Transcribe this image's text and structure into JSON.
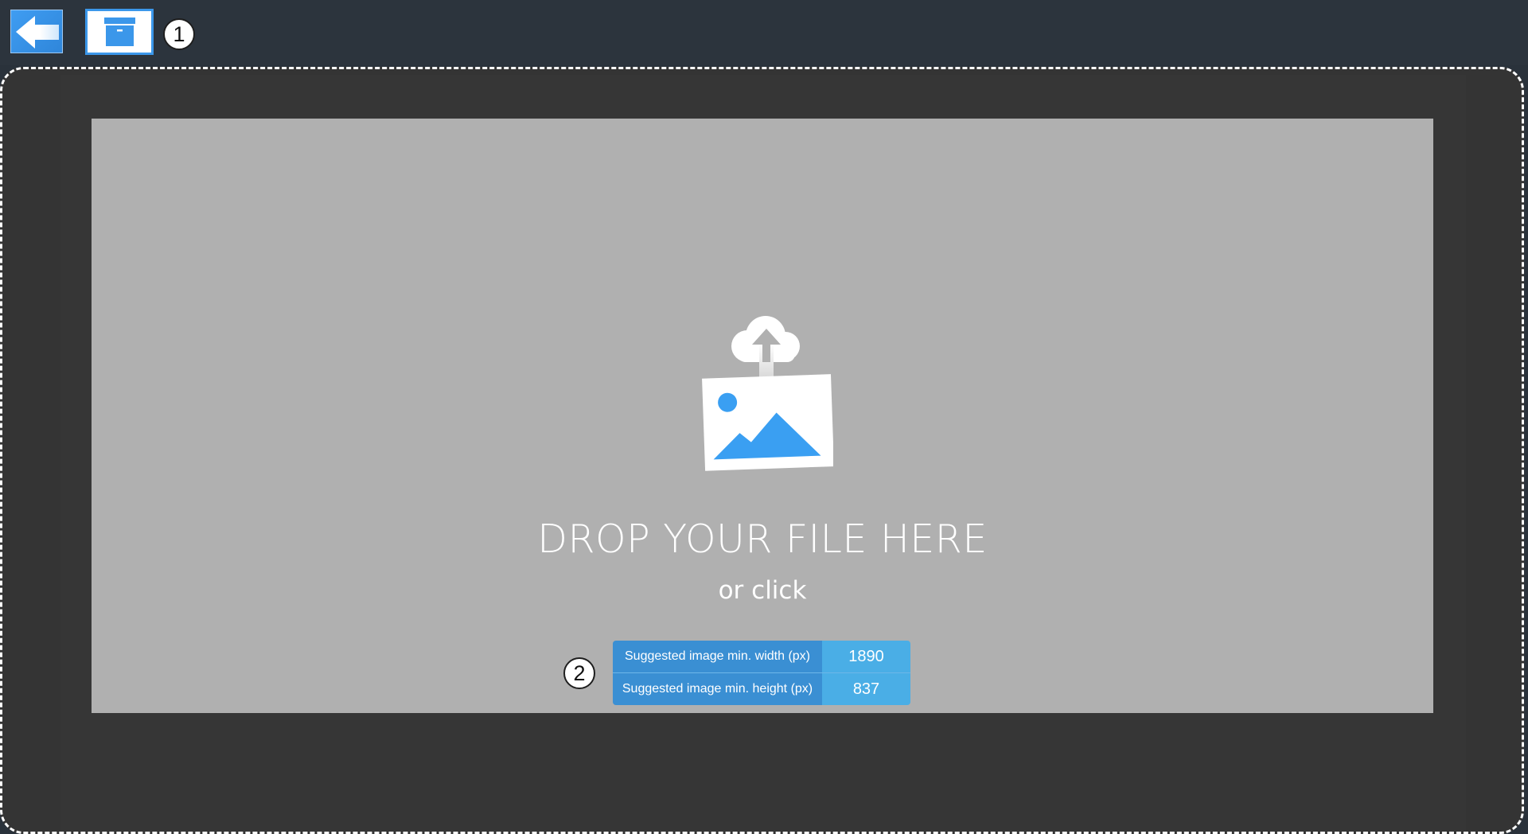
{
  "toolbar": {
    "back_icon": "arrow-left-icon",
    "archive_icon": "archive-box-icon",
    "marker_1": "1"
  },
  "dropzone": {
    "icon": "cloud-upload-image-icon",
    "title": "DROP YOUR FILE HERE",
    "subtitle": "or click",
    "marker_2": "2",
    "requirements": [
      {
        "label": "Suggested image min. width (px)",
        "value": "1890"
      },
      {
        "label": "Suggested image min. height (px)",
        "value": "837"
      }
    ]
  },
  "colors": {
    "accent": "#3b97ea",
    "topbar": "#2c343d",
    "workspace": "#343434",
    "dropzone": "#b0b0b0",
    "label_bg": "#3a8fd3",
    "value_bg": "#4aaee6"
  }
}
